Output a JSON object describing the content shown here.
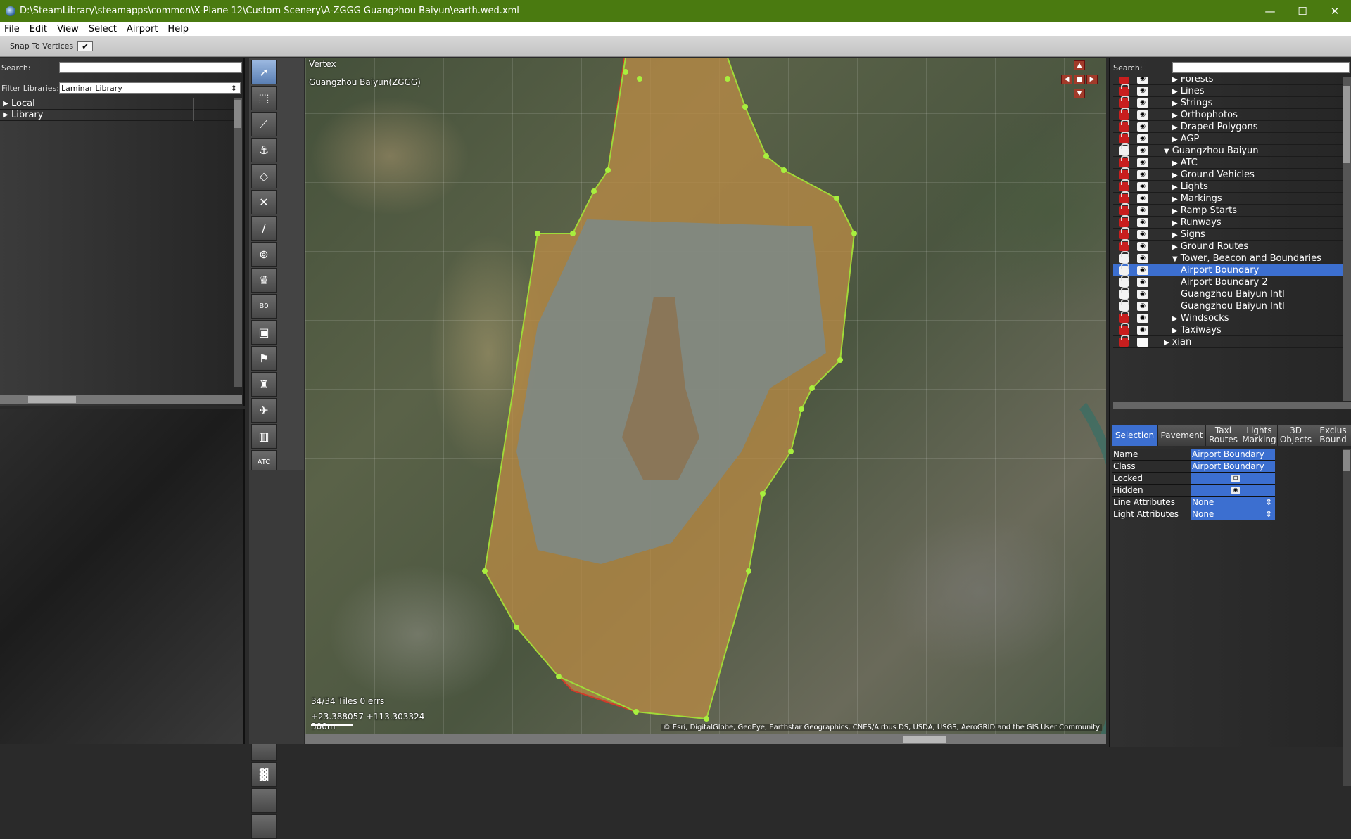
{
  "window": {
    "title": "D:\\SteamLibrary\\steamapps\\common\\X-Plane 12\\Custom Scenery\\A-ZGGG Guangzhou Baiyun\\earth.wed.xml",
    "controls": {
      "minimize": "—",
      "maximize": "☐",
      "close": "✕"
    }
  },
  "menu": [
    "File",
    "Edit",
    "View",
    "Select",
    "Airport",
    "Help"
  ],
  "snapbar": {
    "label": "Snap To Vertices",
    "checked": "✔"
  },
  "library": {
    "search_label": "Search:",
    "search_value": "",
    "filter_label": "Filter Libraries:",
    "filter_value": "Laminar Library",
    "items": [
      {
        "label": "Local",
        "expanded": false
      },
      {
        "label": "Library",
        "expanded": false
      }
    ]
  },
  "tools": [
    {
      "name": "vertex-tool",
      "glyph": "➚",
      "active": true
    },
    {
      "name": "marquee-tool",
      "glyph": "⬚"
    },
    {
      "name": "runway-tool",
      "glyph": "⟋"
    },
    {
      "name": "sealane-tool",
      "glyph": "⚓"
    },
    {
      "name": "helipad-tool",
      "glyph": "◇"
    },
    {
      "name": "taxiway-tool",
      "glyph": "✕"
    },
    {
      "name": "taxiline-tool",
      "glyph": "∕"
    },
    {
      "name": "hole-tool",
      "glyph": "⊚"
    },
    {
      "name": "light-fixture-tool",
      "glyph": "♛"
    },
    {
      "name": "sign-tool",
      "glyph": "B0"
    },
    {
      "name": "boundary-tool",
      "glyph": "▣"
    },
    {
      "name": "windsock-tool",
      "glyph": "⚑"
    },
    {
      "name": "tower-tool",
      "glyph": "♜"
    },
    {
      "name": "ramp-start-tool",
      "glyph": "✈"
    },
    {
      "name": "facade-tool",
      "glyph": "▥"
    },
    {
      "name": "atc-tool",
      "glyph": "ATC"
    },
    {
      "name": "object-tool",
      "glyph": "▦"
    },
    {
      "name": "object-string-tool",
      "glyph": "▤"
    },
    {
      "name": "forest-tool",
      "glyph": "♣"
    },
    {
      "name": "string-tool",
      "glyph": "⋰"
    },
    {
      "name": "line-tool",
      "glyph": "⌇"
    },
    {
      "name": "polygon-tool",
      "glyph": "▰"
    },
    {
      "name": "exclusion-tool",
      "glyph": "✗"
    },
    {
      "name": "route-tool",
      "glyph": "⟆"
    },
    {
      "name": "truck-tool",
      "glyph": "▬"
    },
    {
      "name": "marking-tool",
      "glyph": "▬"
    },
    {
      "name": "empty-tool-1",
      "glyph": ""
    },
    {
      "name": "path-tool",
      "glyph": "▓"
    },
    {
      "name": "empty-tool-2",
      "glyph": ""
    },
    {
      "name": "empty-tool-3",
      "glyph": ""
    }
  ],
  "map": {
    "tool_label": "Vertex",
    "airport_label": "Guangzhou Baiyun(ZGGG)",
    "tiles_status": "34/34 Tiles 0 errs",
    "coords": "+23.388057 +113.303324",
    "scale": "300m",
    "attribution": "© Esri, DigitalGlobe, GeoEye, Earthstar Geographics, CNES/Airbus DS, USDA, USGS, AeroGRID and the GIS User Community"
  },
  "layers": {
    "search_label": "Search:",
    "rows": [
      {
        "label": "Forests",
        "tri": "▶",
        "indent": 2,
        "locked": true,
        "visible": true
      },
      {
        "label": "Lines",
        "tri": "▶",
        "indent": 2,
        "locked": true,
        "visible": true
      },
      {
        "label": "Strings",
        "tri": "▶",
        "indent": 2,
        "locked": true,
        "visible": true
      },
      {
        "label": "Orthophotos",
        "tri": "▶",
        "indent": 2,
        "locked": true,
        "visible": true
      },
      {
        "label": "Draped Polygons",
        "tri": "▶",
        "indent": 2,
        "locked": true,
        "visible": true
      },
      {
        "label": "AGP",
        "tri": "▶",
        "indent": 2,
        "locked": true,
        "visible": true
      },
      {
        "label": "Guangzhou Baiyun",
        "tri": "▼",
        "indent": 1,
        "locked": false,
        "visible": true
      },
      {
        "label": "ATC",
        "tri": "▶",
        "indent": 2,
        "locked": true,
        "visible": true
      },
      {
        "label": "Ground Vehicles",
        "tri": "▶",
        "indent": 2,
        "locked": true,
        "visible": true
      },
      {
        "label": "Lights",
        "tri": "▶",
        "indent": 2,
        "locked": true,
        "visible": true
      },
      {
        "label": "Markings",
        "tri": "▶",
        "indent": 2,
        "locked": true,
        "visible": true
      },
      {
        "label": "Ramp Starts",
        "tri": "▶",
        "indent": 2,
        "locked": true,
        "visible": true
      },
      {
        "label": "Runways",
        "tri": "▶",
        "indent": 2,
        "locked": true,
        "visible": true
      },
      {
        "label": "Signs",
        "tri": "▶",
        "indent": 2,
        "locked": true,
        "visible": true
      },
      {
        "label": "Ground Routes",
        "tri": "▶",
        "indent": 2,
        "locked": true,
        "visible": true
      },
      {
        "label": "Tower, Beacon and Boundaries",
        "tri": "▼",
        "indent": 2,
        "locked": false,
        "visible": true
      },
      {
        "label": "Airport Boundary",
        "tri": "",
        "indent": 3,
        "locked": false,
        "visible": true,
        "selected": true
      },
      {
        "label": "Airport Boundary 2",
        "tri": "",
        "indent": 3,
        "locked": false,
        "visible": true
      },
      {
        "label": "Guangzhou Baiyun Intl",
        "tri": "",
        "indent": 3,
        "locked": false,
        "visible": true
      },
      {
        "label": "Guangzhou Baiyun Intl",
        "tri": "",
        "indent": 3,
        "locked": false,
        "visible": true
      },
      {
        "label": "Windsocks",
        "tri": "▶",
        "indent": 2,
        "locked": true,
        "visible": true
      },
      {
        "label": "Taxiways",
        "tri": "▶",
        "indent": 2,
        "locked": true,
        "visible": true
      },
      {
        "label": "xian",
        "tri": "▶",
        "indent": 1,
        "locked": true,
        "visible": false
      }
    ]
  },
  "tabs": [
    {
      "label": "Selection",
      "active": true,
      "w": 66
    },
    {
      "label": "Pavement",
      "w": 68
    },
    {
      "label": "Taxi Routes",
      "w": 50
    },
    {
      "label": "Lights Marking",
      "w": 52
    },
    {
      "label": "3D Objects",
      "w": 52
    },
    {
      "label": "Exclus Bound",
      "w": 54
    }
  ],
  "properties": [
    {
      "label": "Name",
      "value": "Airport Boundary",
      "kind": "text"
    },
    {
      "label": "Class",
      "value": "Airport Boundary",
      "kind": "text"
    },
    {
      "label": "Locked",
      "value": "",
      "kind": "lock"
    },
    {
      "label": "Hidden",
      "value": "",
      "kind": "eye"
    },
    {
      "label": "Line Attributes",
      "value": "None",
      "kind": "select"
    },
    {
      "label": "Light Attributes",
      "value": "None",
      "kind": "select"
    }
  ]
}
